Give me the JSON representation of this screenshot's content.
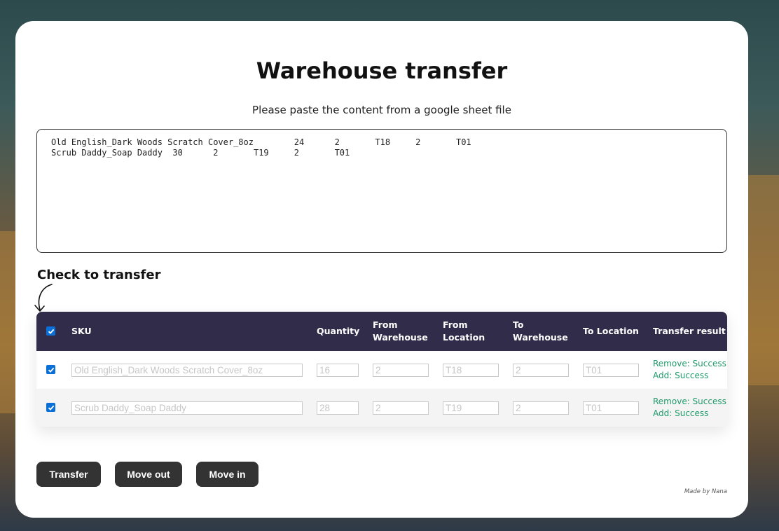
{
  "page": {
    "title": "Warehouse transfer",
    "subtitle": "Please paste the content from a google sheet file",
    "paste_content": "Old English_Dark Woods Scratch Cover_8oz        24      2       T18     2       T01\nScrub Daddy_Soap Daddy  30      2       T19     2       T01",
    "check_label": "Check to transfer",
    "credit": "Made by Nana"
  },
  "table": {
    "header_checked": true,
    "columns": {
      "sku": "SKU",
      "quantity": "Quantity",
      "from_warehouse": "From Warehouse",
      "from_location": "From Location",
      "to_warehouse": "To Warehouse",
      "to_location": "To Location",
      "transfer_result": "Transfer result"
    },
    "rows": [
      {
        "checked": true,
        "sku": "Old English_Dark Woods Scratch Cover_8oz",
        "quantity": "16",
        "from_warehouse": "2",
        "from_location": "T18",
        "to_warehouse": "2",
        "to_location": "T01",
        "result_remove": "Remove: Success",
        "result_add": "Add: Success"
      },
      {
        "checked": true,
        "sku": "Scrub Daddy_Soap Daddy",
        "quantity": "28",
        "from_warehouse": "2",
        "from_location": "T19",
        "to_warehouse": "2",
        "to_location": "T01",
        "result_remove": "Remove: Success",
        "result_add": "Add: Success"
      }
    ]
  },
  "buttons": {
    "transfer": "Transfer",
    "move_out": "Move out",
    "move_in": "Move in"
  },
  "colors": {
    "header_bg": "#302c4a",
    "success_text": "#1f9a6a",
    "button_bg": "#333333",
    "checkbox_blue": "#0b6fd8"
  }
}
